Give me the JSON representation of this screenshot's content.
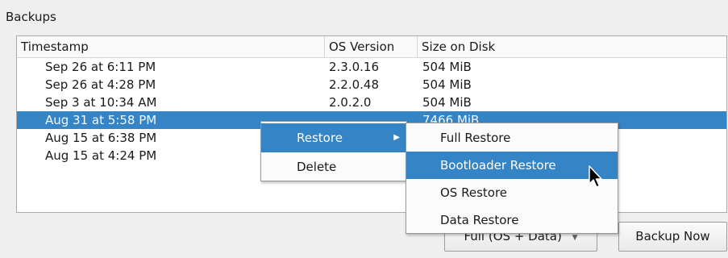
{
  "backups": {
    "group_title": "Backups",
    "columns": [
      "Timestamp",
      "OS Version",
      "Size on Disk"
    ],
    "rows": [
      {
        "timestamp": "Sep 26 at 6:11 PM",
        "os_version": "2.3.0.16",
        "size": "504 MiB"
      },
      {
        "timestamp": "Sep 26 at 4:28 PM",
        "os_version": "2.2.0.48",
        "size": "504 MiB"
      },
      {
        "timestamp": "Sep 3 at 10:34 AM",
        "os_version": "2.0.2.0",
        "size": "504 MiB"
      },
      {
        "timestamp": "Aug 31 at 5:58 PM",
        "os_version": "",
        "size": "7466 MiB",
        "selected": true
      },
      {
        "timestamp": "Aug 15 at 6:38 PM",
        "os_version": "",
        "size": ""
      },
      {
        "timestamp": "Aug 15 at 4:24 PM",
        "os_version": "",
        "size": ""
      }
    ]
  },
  "controls": {
    "backup_type_value": "Full (OS + Data)",
    "backup_now_label": "Backup Now"
  },
  "context_menu": {
    "items": [
      "Restore",
      "Delete"
    ],
    "active_item": "Restore",
    "submenu": {
      "items": [
        "Full Restore",
        "Bootloader Restore",
        "OS Restore",
        "Data Restore"
      ],
      "active_item": "Bootloader Restore"
    }
  },
  "colors": {
    "selection": "#3584c6",
    "background": "#efefef"
  },
  "icons": [
    "submenu-arrow-icon",
    "dropdown-arrow-icon",
    "mouse-pointer-icon"
  ]
}
